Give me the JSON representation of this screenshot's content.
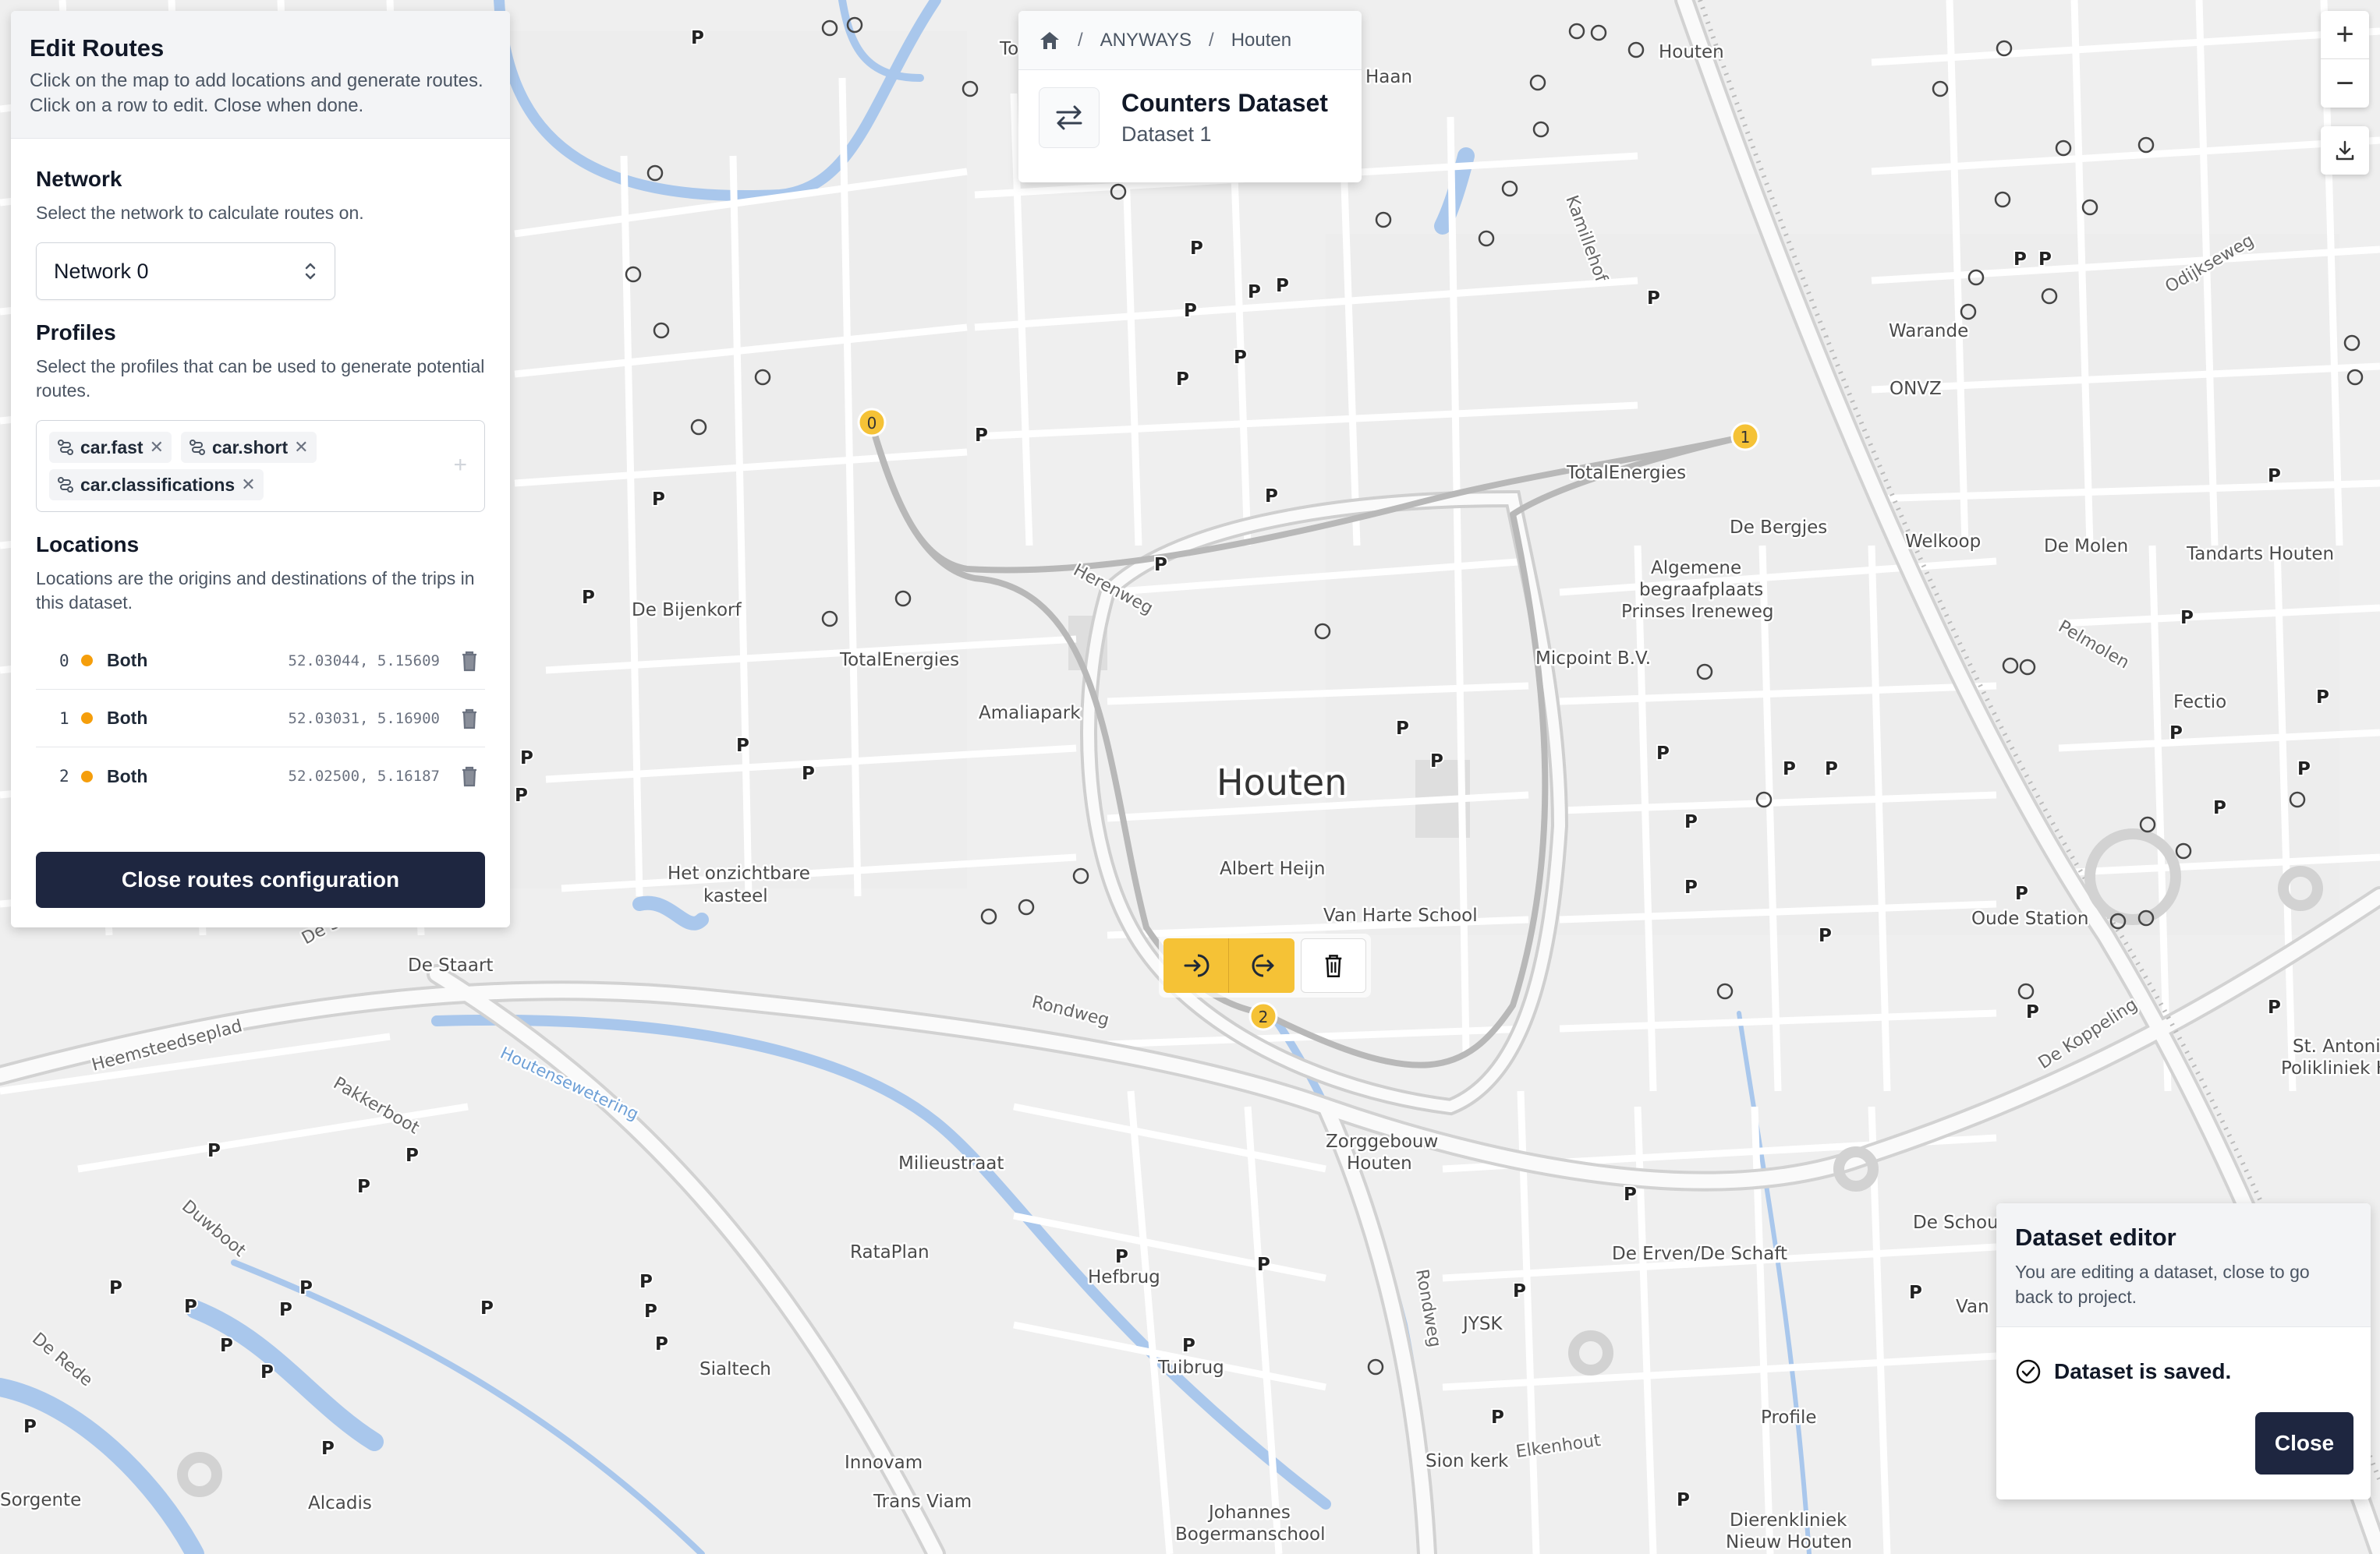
{
  "edit_panel": {
    "title": "Edit Routes",
    "description": "Click on the map to add locations and generate routes. Click on a row to edit. Close when done.",
    "network": {
      "title": "Network",
      "description": "Select the network to calculate routes on.",
      "selected": "Network 0"
    },
    "profiles": {
      "title": "Profiles",
      "description": "Select the profiles that can be used to generate potential routes.",
      "chips": [
        "car.fast",
        "car.short",
        "car.classifications"
      ]
    },
    "locations": {
      "title": "Locations",
      "description": "Locations are the origins and destinations of the trips in this dataset.",
      "rows": [
        {
          "index": "0",
          "role": "Both",
          "coord": "52.03044, 5.15609"
        },
        {
          "index": "1",
          "role": "Both",
          "coord": "52.03031, 5.16900"
        },
        {
          "index": "2",
          "role": "Both",
          "coord": "52.02500, 5.16187"
        }
      ]
    },
    "close_label": "Close routes configuration"
  },
  "breadcrumb": {
    "items": [
      "ANYWAYS",
      "Houten"
    ],
    "dataset_title": "Counters Dataset",
    "dataset_subtitle": "Dataset 1"
  },
  "dataset_editor": {
    "title": "Dataset editor",
    "description": "You are editing a dataset, close to go back to project.",
    "status": "Dataset is saved.",
    "close_label": "Close"
  },
  "map_controls": {
    "zoom_in": "+",
    "zoom_out": "−"
  },
  "markers": [
    {
      "label": "0"
    },
    {
      "label": "1"
    },
    {
      "label": "2"
    }
  ],
  "map_labels": {
    "city": "Houten",
    "places": [
      "De Bijenkorf",
      "TotalEnergies",
      "Amaliapark",
      "Het onzichtbare",
      "kasteel",
      "Albert Heijn",
      "Van Harte School",
      "TotalEnergies",
      "De Bergjes",
      "Algemene",
      "begraafplaats",
      "Prinses Ireneweg",
      "Micpoint B.V.",
      "Houten",
      "Warande",
      "ONVZ",
      "Welkoop",
      "De Molen",
      "Tandarts Houten",
      "Fectio",
      "Oude Station",
      "St. Antoniu",
      "Polikliniek Ho",
      "De Staart",
      "Milieustraat",
      "RataPlan",
      "Hefbrug",
      "Tuibrug",
      "Sialtech",
      "Innovam",
      "Trans Viam",
      "Johannes",
      "Bogermanschool",
      "Zorggebouw",
      "Houten",
      "JYSK",
      "Sion kerk",
      "De Erven/De Schaft",
      "De Schouw",
      "Profile",
      "Dierenkliniek",
      "Nieuw Houten",
      "Alcadis",
      "Sorgente",
      "Haan",
      "Van",
      "To"
    ],
    "streets": [
      "Herenweg",
      "Rondweg",
      "Heemsteedseplad",
      "Pakkerboot",
      "Duwboot",
      "De Rede",
      "Rondweg",
      "Elkenhout",
      "De Koppeling",
      "Pelmolen",
      "Odijkseweg",
      "Kamillehof",
      "De Sl"
    ],
    "water": [
      "Houtensewetering"
    ],
    "parking": "P"
  }
}
